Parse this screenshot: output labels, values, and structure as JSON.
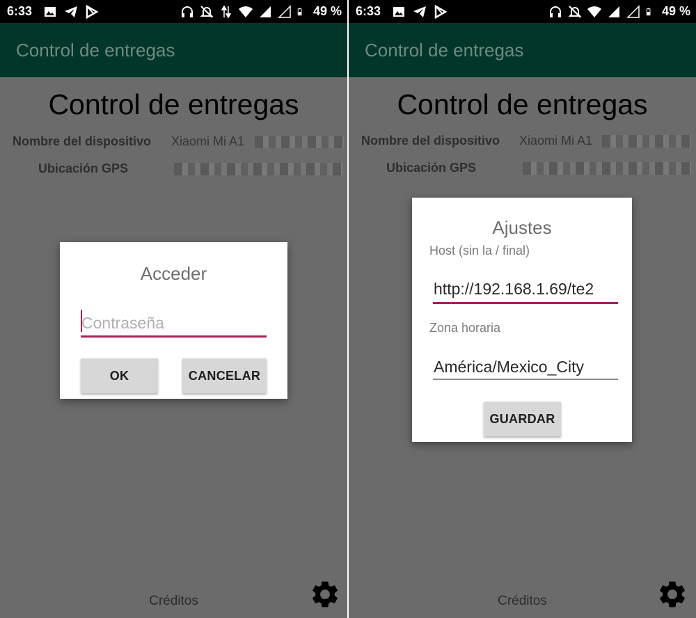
{
  "status_bar": {
    "time": "6:33",
    "battery": "49 %",
    "left_icons": [
      "image-icon",
      "telegram-icon",
      "play-store-icon"
    ],
    "right_icons": [
      "headphones-icon",
      "notifications-off-icon",
      "data-arrows-icon",
      "wifi-icon",
      "signal-icon",
      "signal-empty-icon",
      "battery-icon"
    ]
  },
  "app_bar": {
    "title": "Control de entregas"
  },
  "main": {
    "title": "Control de entregas",
    "device_label": "Nombre del dispositivo",
    "device_value": "Xiaomi Mi A1",
    "gps_label": "Ubicación GPS",
    "credits": "Créditos",
    "settings_icon": "gear-icon"
  },
  "login_dialog": {
    "title": "Acceder",
    "password_placeholder": "Contraseña",
    "ok_label": "OK",
    "cancel_label": "CANCELAR"
  },
  "settings_dialog": {
    "title": "Ajustes",
    "host_label": "Host (sin la / final)",
    "host_value": "http://192.168.1.69/te2",
    "timezone_label": "Zona horaria",
    "timezone_value": "América/Mexico_City",
    "save_label": "GUARDAR"
  },
  "colors": {
    "app_bar": "#02362b",
    "accent": "#a8215c",
    "scrim": "#6b6b6b"
  }
}
